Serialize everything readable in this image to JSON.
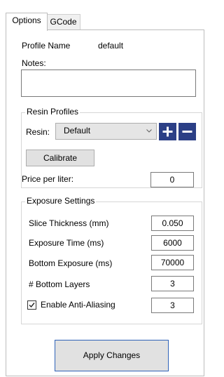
{
  "tabs": [
    {
      "label": "Options"
    },
    {
      "label": "GCode"
    }
  ],
  "profile": {
    "name_label": "Profile Name",
    "name_value": "default",
    "notes_label": "Notes:",
    "notes_value": ""
  },
  "resin_profiles": {
    "title": "Resin Profiles",
    "resin_label": "Resin:",
    "resin_selected": "Default",
    "add_icon": "plus-icon",
    "remove_icon": "minus-icon",
    "calibrate_label": "Calibrate",
    "price_label": "Price per liter:",
    "price_value": "0"
  },
  "exposure_settings": {
    "title": "Exposure Settings",
    "rows": [
      {
        "label": "Slice Thickness (mm)",
        "value": "0.050"
      },
      {
        "label": "Exposure Time (ms)",
        "value": "6000"
      },
      {
        "label": "Bottom Exposure (ms)",
        "value": "70000"
      },
      {
        "label": "# Bottom Layers",
        "value": "3"
      }
    ],
    "anti_aliasing": {
      "label": "Enable Anti-Aliasing",
      "checked": true,
      "value": "3"
    }
  },
  "apply_button": {
    "label": "Apply Changes"
  },
  "colors": {
    "icon_button": "#2b3f86",
    "apply_border": "#2f62b8"
  }
}
